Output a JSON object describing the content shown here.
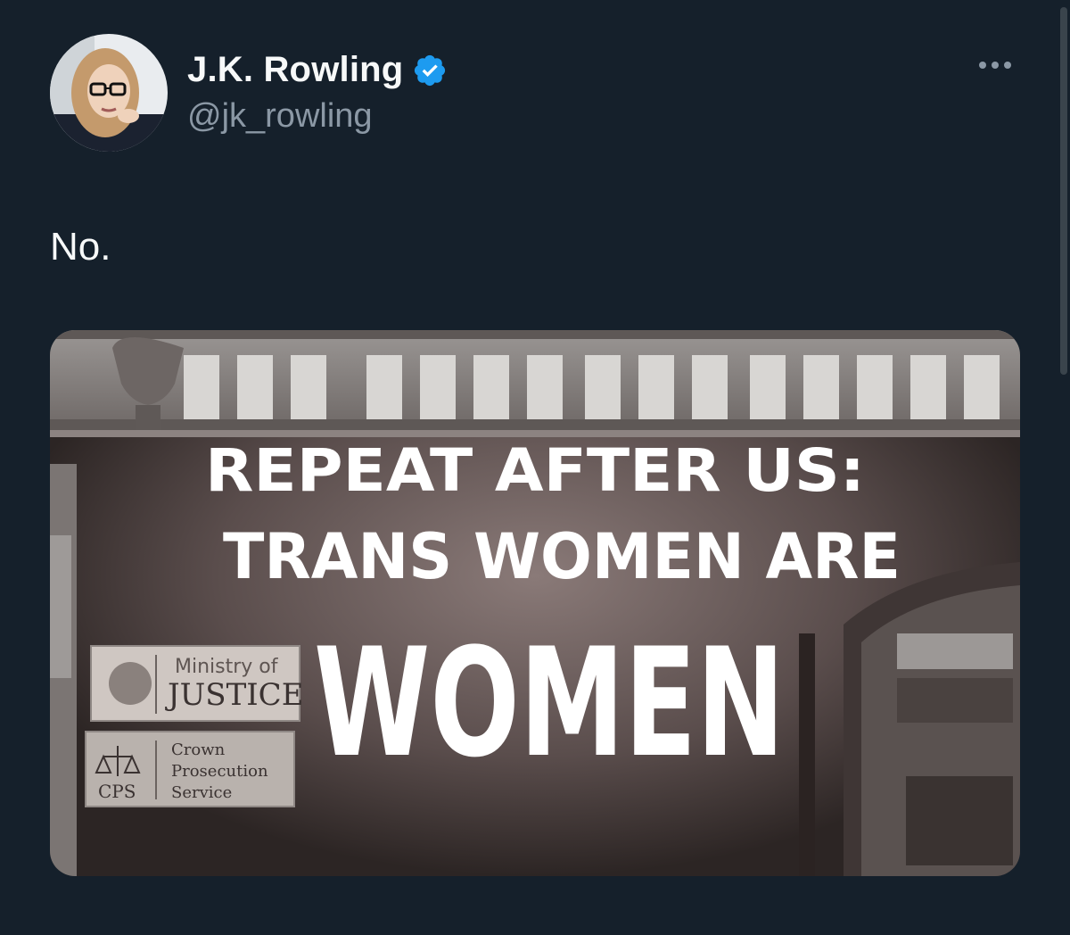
{
  "author": {
    "display_name": "J.K. Rowling",
    "handle": "@jk_rowling",
    "verified": true,
    "verified_color": "#1d9bf0"
  },
  "tweet": {
    "text": "No."
  },
  "media": {
    "projection_lines": [
      "REPEAT AFTER US:",
      "TRANS WOMEN ARE",
      "WOMEN"
    ],
    "sign_ministry": {
      "line1": "Ministry of",
      "line2": "JUSTICE"
    },
    "sign_cps": {
      "abbrev": "CPS",
      "line1": "Crown",
      "line2": "Prosecution",
      "line3": "Service"
    }
  },
  "icons": {
    "more": "more-options-icon",
    "verified": "verified-badge-icon"
  },
  "colors": {
    "background": "#15202b",
    "text_primary": "#f7f9f9",
    "text_secondary": "#8b98a5"
  }
}
